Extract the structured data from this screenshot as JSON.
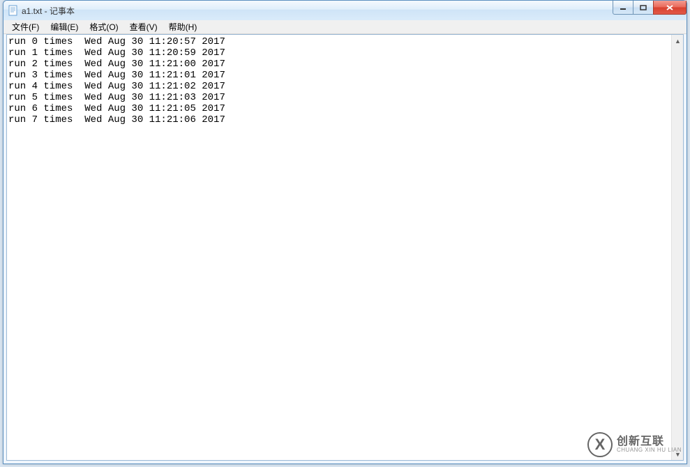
{
  "window": {
    "title": "a1.txt - 记事本"
  },
  "menu": {
    "file": "文件(F)",
    "edit": "编辑(E)",
    "format": "格式(O)",
    "view": "查看(V)",
    "help": "帮助(H)"
  },
  "content": {
    "lines": [
      "run 0 times  Wed Aug 30 11:20:57 2017",
      "run 1 times  Wed Aug 30 11:20:59 2017",
      "run 2 times  Wed Aug 30 11:21:00 2017",
      "run 3 times  Wed Aug 30 11:21:01 2017",
      "run 4 times  Wed Aug 30 11:21:02 2017",
      "run 5 times  Wed Aug 30 11:21:03 2017",
      "run 6 times  Wed Aug 30 11:21:05 2017",
      "run 7 times  Wed Aug 30 11:21:06 2017"
    ]
  },
  "watermark": {
    "logo_letter": "X",
    "cn": "创新互联",
    "en": "CHUANG XIN HU LIAN"
  }
}
